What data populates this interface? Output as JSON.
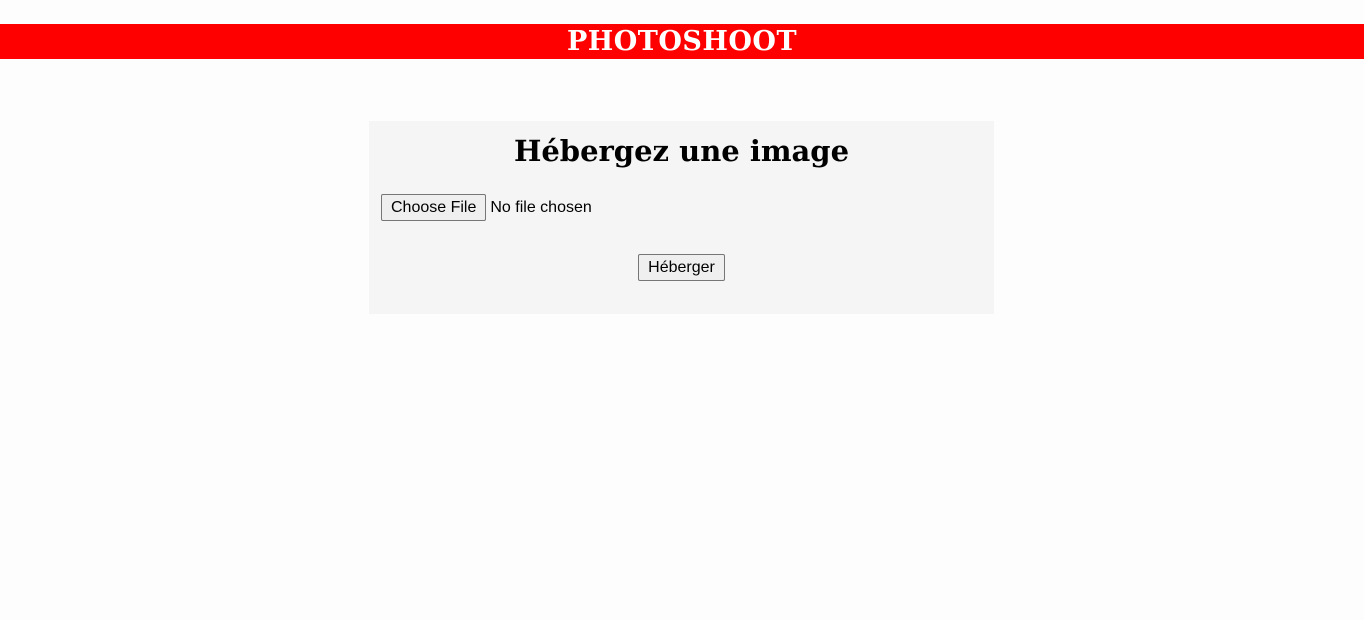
{
  "header": {
    "title": "PHOTOSHOOT",
    "background_color": "#ff0000",
    "title_color": "#ffffff"
  },
  "upload_form": {
    "heading": "Hébergez une image",
    "file_input": {
      "button_label": "Choose File",
      "status_text": "No file chosen"
    },
    "submit_label": "Héberger",
    "panel_background": "#f5f5f5"
  }
}
